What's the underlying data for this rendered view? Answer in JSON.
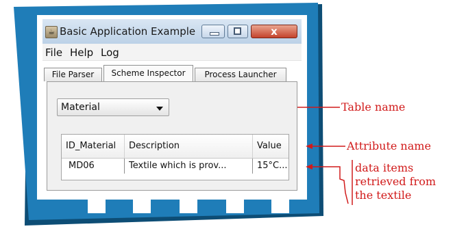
{
  "window": {
    "title": "Basic Application Example",
    "close_glyph": "x"
  },
  "menu": [
    "File",
    "Help",
    "Log"
  ],
  "tabs": [
    {
      "label": "File Parser",
      "selected": false
    },
    {
      "label": "Scheme Inspector",
      "selected": true
    },
    {
      "label": "Process Launcher",
      "selected": false
    }
  ],
  "table_select": {
    "value": "Material"
  },
  "table": {
    "headers": [
      "ID_Material",
      "Description",
      "Value"
    ],
    "rows": [
      [
        "MD06",
        "Textile which is prov...",
        "15°C..."
      ]
    ]
  },
  "annotations": {
    "table_name": "Table name",
    "attribute_name": "Attribute name",
    "data_items": [
      "data items",
      "retrieved from",
      "the textile"
    ]
  },
  "colors": {
    "frame": "#1d79b3",
    "frame_dark": "#0d4d75",
    "annotation": "#d11a1a",
    "square": "#ffffff"
  }
}
